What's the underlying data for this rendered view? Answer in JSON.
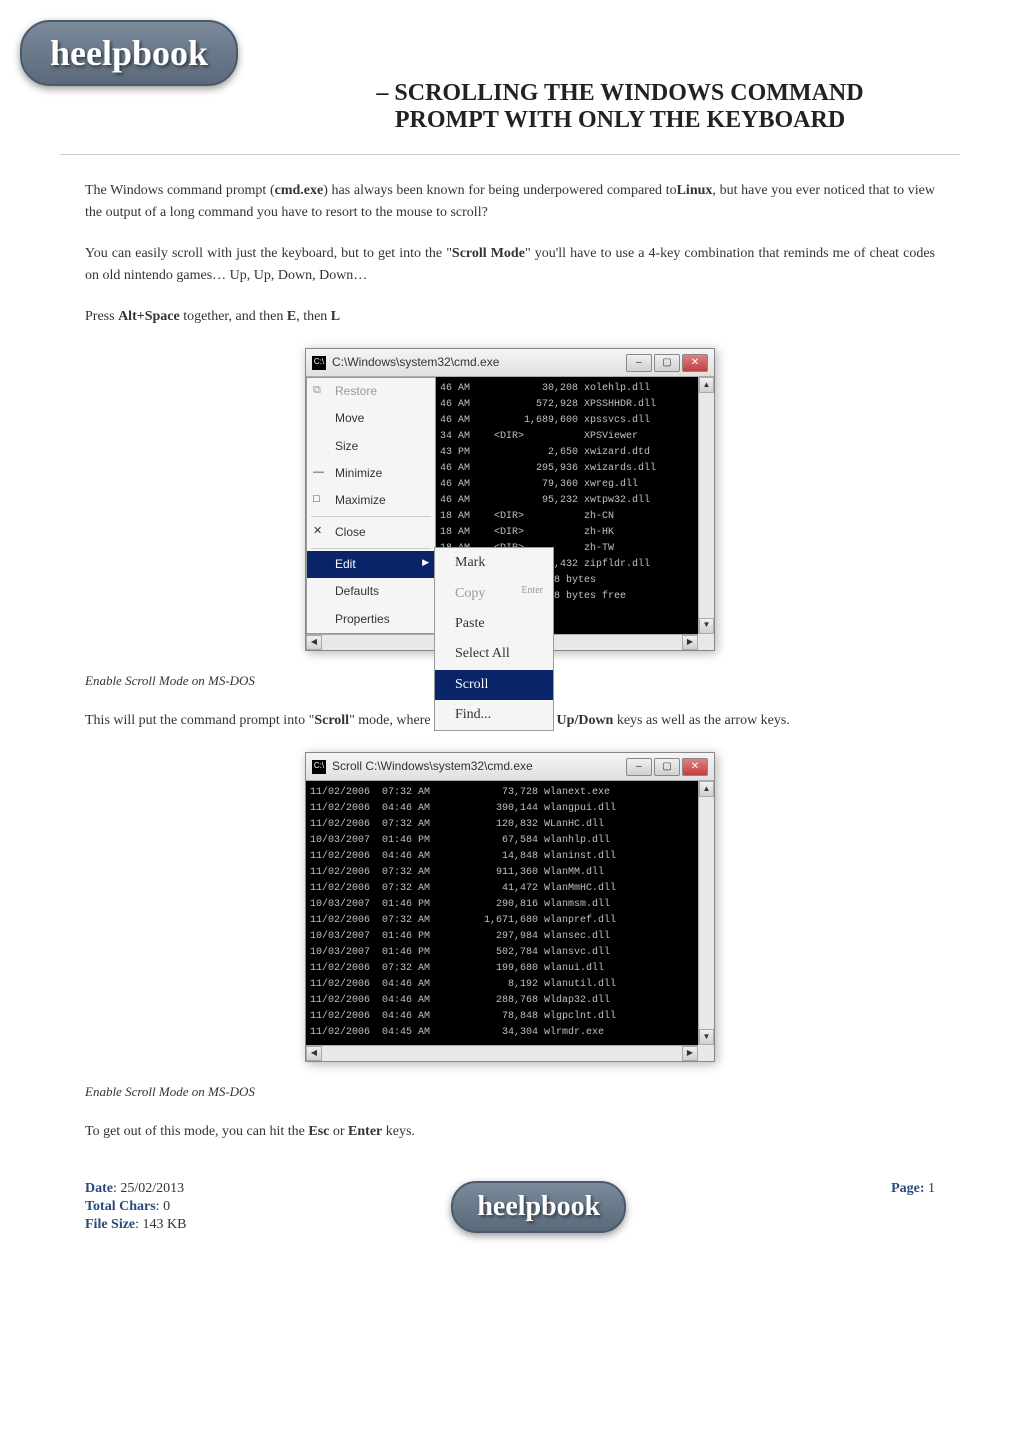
{
  "brand": "heelpbook",
  "title_line": "– SCROLLING THE WINDOWS COMMAND PROMPT WITH ONLY THE KEYBOARD",
  "para1_a": "The Windows command prompt (",
  "para1_b": "cmd.exe",
  "para1_c": ") has always been known for being underpowered compared to",
  "para1_d": "Linux",
  "para1_e": ", but have you ever noticed that to view the output of a long command you have to resort to the mouse to scroll?",
  "para2_a": "You can easily scroll with just the keyboard, but to get into the \"",
  "para2_b": "Scroll Mode",
  "para2_c": "\" you'll have to use a 4-key combination that reminds me of cheat codes on old nintendo games… Up, Up, Down, Down…",
  "para3_a": "Press ",
  "para3_b": "Alt+Space",
  "para3_c": " together, and then ",
  "para3_d": "E",
  "para3_e": ", then ",
  "para3_f": "L",
  "screenshot1": {
    "titlebar": "C:\\Windows\\system32\\cmd.exe",
    "system_menu": {
      "restore": "Restore",
      "move": "Move",
      "size": "Size",
      "minimize": "Minimize",
      "maximize": "Maximize",
      "close": "Close",
      "edit": "Edit",
      "defaults": "Defaults",
      "properties": "Properties"
    },
    "edit_submenu": {
      "mark": "Mark",
      "copy": "Copy",
      "copy_shortcut": "Enter",
      "paste": "Paste",
      "select_all": "Select All",
      "scroll": "Scroll",
      "find": "Find..."
    },
    "output": "46 AM            30,208 xolehlp.dll\n46 AM           572,928 XPSSHHDR.dll\n46 AM         1,689,600 xpssvcs.dll\n34 AM    <DIR>          XPSViewer\n43 PM             2,650 xwizard.dtd\n46 AM           295,936 xwizards.dll\n46 AM            79,360 xwreg.dll\n46 AM            95,232 xwtpw32.dll\n18 AM    <DIR>          zh-CN\n18 AM    <DIR>          zh-HK\n18 AM    <DIR>          zh-TW\n                338,432 zipfldr.dll\n            ,521,778 bytes\n           1,304,768 bytes free"
  },
  "caption1": "Enable Scroll Mode on MS-DOS",
  "para4_a": "This will put the command prompt into \"",
  "para4_b": "Scroll",
  "para4_c": "\" mode, where you can use the ",
  "para4_d": "Page Up/Down",
  "para4_e": " keys as well as the arrow keys.",
  "screenshot2": {
    "titlebar": "Scroll C:\\Windows\\system32\\cmd.exe",
    "output": "11/02/2006  07:32 AM            73,728 wlanext.exe\n11/02/2006  04:46 AM           390,144 wlangpui.dll\n11/02/2006  07:32 AM           120,832 WLanHC.dll\n10/03/2007  01:46 PM            67,584 wlanhlp.dll\n11/02/2006  04:46 AM            14,848 wlaninst.dll\n11/02/2006  07:32 AM           911,360 WlanMM.dll\n11/02/2006  07:32 AM            41,472 WlanMmHC.dll\n10/03/2007  01:46 PM           290,816 wlanmsm.dll\n11/02/2006  07:32 AM         1,671,680 wlanpref.dll\n10/03/2007  01:46 PM           297,984 wlansec.dll\n10/03/2007  01:46 PM           502,784 wlansvc.dll\n11/02/2006  07:32 AM           199,680 wlanui.dll\n11/02/2006  04:46 AM             8,192 wlanutil.dll\n11/02/2006  04:46 AM           288,768 Wldap32.dll\n11/02/2006  04:46 AM            78,848 wlgpclnt.dll\n11/02/2006  04:45 AM            34,304 wlrmdr.exe"
  },
  "caption2": "Enable Scroll Mode on MS-DOS",
  "para5_a": "To get out of this mode, you can hit the ",
  "para5_b": "Esc",
  "para5_c": " or ",
  "para5_d": "Enter",
  "para5_e": " keys.",
  "footer": {
    "date_label": "Date",
    "date_value": "25/02/2013",
    "chars_label": "Total Chars",
    "chars_value": "0",
    "size_label": "File Size",
    "size_value": "143 KB",
    "page_label": "Page",
    "page_value": "1"
  }
}
